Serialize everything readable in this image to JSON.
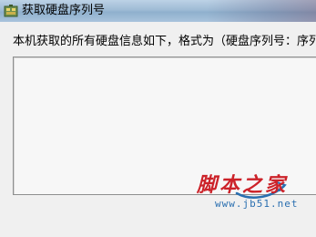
{
  "window": {
    "title": "获取硬盘序列号",
    "icon": "app-icon"
  },
  "main": {
    "instruction": "本机获取的所有硬盘信息如下，格式为（硬盘序列号：序列号错",
    "result_text": ""
  },
  "watermark": {
    "brand": "脚本之家",
    "url": "www.jb51.net"
  },
  "colors": {
    "titlebar": "#9fbbd5",
    "client_bg": "#f0f0f0",
    "watermark_red": "#cc2229",
    "watermark_blue": "#2a6fb0"
  }
}
